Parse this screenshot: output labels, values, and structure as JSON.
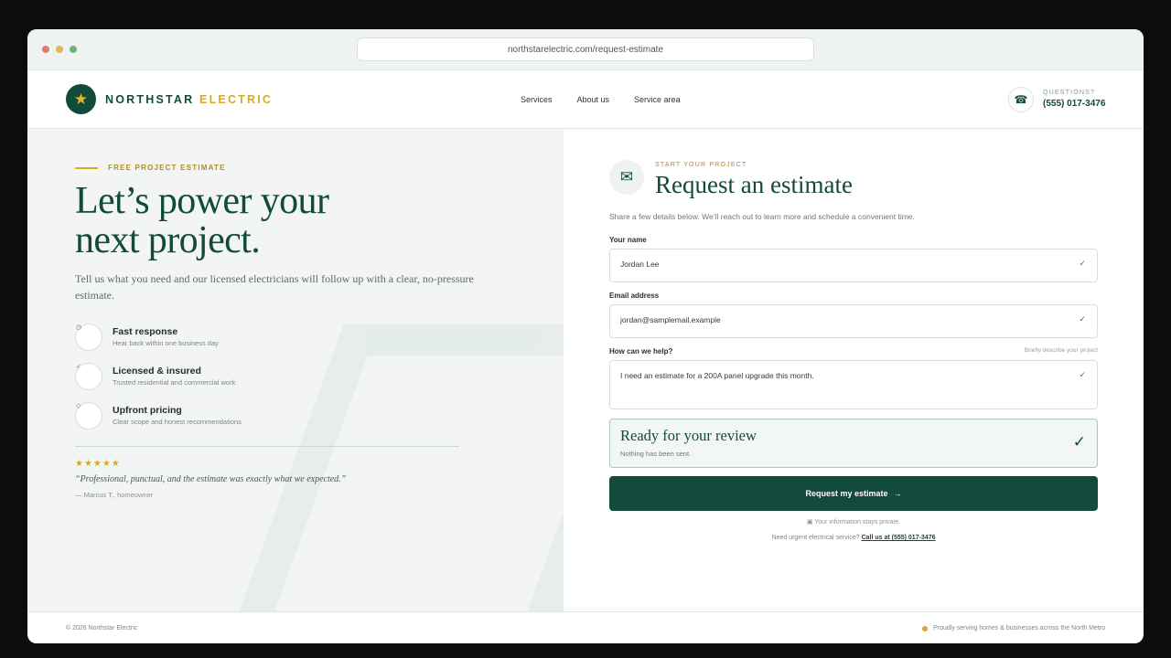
{
  "browser": {
    "url": "northstarelectric.com/request-estimate"
  },
  "header": {
    "brand_main": "NORTHSTAR",
    "brand_accent": "ELECTRIC",
    "nav": [
      "Services",
      "About us",
      "Service area"
    ],
    "questions_label": "QUESTIONS?",
    "phone": "(555) 017-3476"
  },
  "hero": {
    "eyebrow": "FREE PROJECT ESTIMATE",
    "headline_line1": "Let’s power your",
    "headline_line2": "next project.",
    "subtext": "Tell us what you need and our licensed electricians will follow up with a clear, no-pressure estimate.",
    "features": [
      {
        "mark": "◷",
        "title": "Fast response",
        "desc": "Hear back within one business day"
      },
      {
        "mark": "✓",
        "title": "Licensed & insured",
        "desc": "Trusted residential and commercial work"
      },
      {
        "mark": "◇",
        "title": "Upfront pricing",
        "desc": "Clear scope and honest recommendations"
      }
    ],
    "stars": "★★★★★",
    "quote": "“Professional, punctual, and the estimate was exactly what we expected.”",
    "attribution": "— Marcus T., homeowner"
  },
  "form": {
    "eyebrow": "START YOUR PROJECT",
    "title": "Request an estimate",
    "subtitle": "Share a few details below. We’ll reach out to learn more and schedule a convenient time.",
    "name_label": "Your name",
    "name_value": "Jordan Lee",
    "email_label": "Email address",
    "email_value": "jordan@samplemail.example",
    "help_label": "How can we help?",
    "help_hint": "Briefly describe your project",
    "help_value": "I need an estimate for a 200A panel upgrade this month.",
    "check": "✓",
    "review_title": "Ready for your review",
    "review_sub": "Nothing has been sent.",
    "submit_label": "Request my estimate",
    "submit_arrow": "→",
    "private_note": "▣ Your information stays private.",
    "urgent_text": "Need urgent electrical service?",
    "urgent_link": "Call us at (555) 017-3476"
  },
  "footer": {
    "copyright": "© 2026 Northstar Electric",
    "serving": "Proudly serving homes & businesses across the North Metro"
  },
  "colors": {
    "primary": "#124a3c",
    "accent": "#d6a92b",
    "background_panel": "#f2f5f3"
  }
}
